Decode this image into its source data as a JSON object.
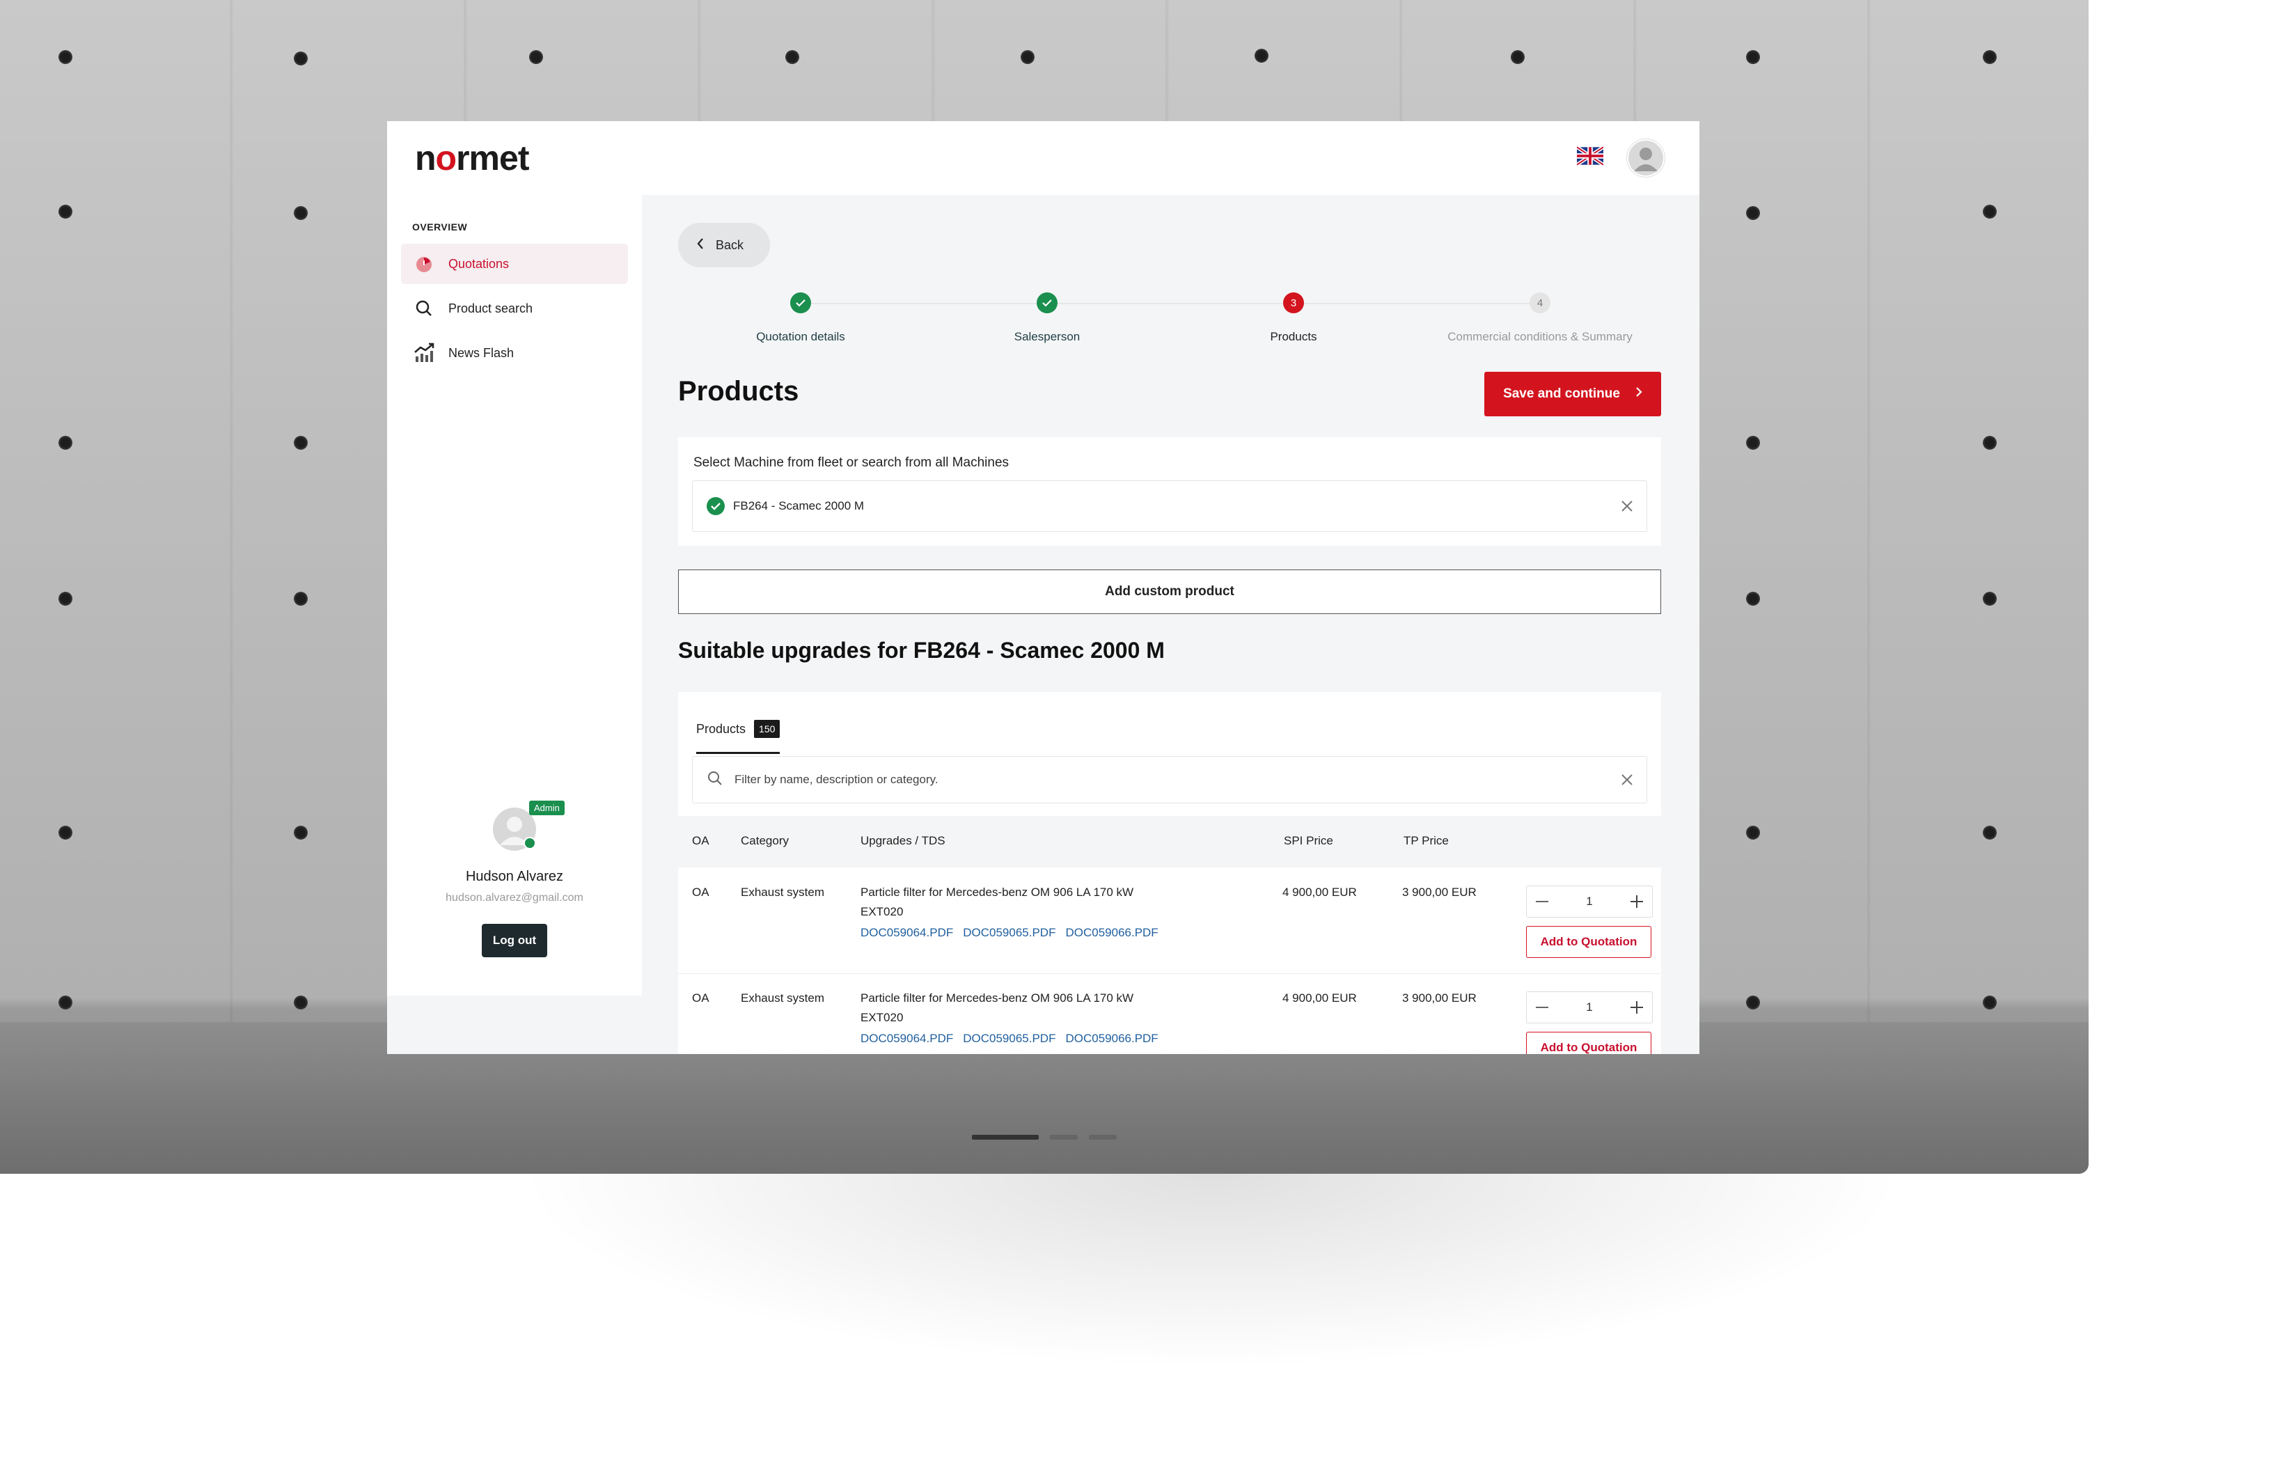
{
  "brand": {
    "logo_text_1": "n",
    "logo_text_o": "o",
    "logo_text_2": "rmet",
    "accent": "#d3141f",
    "success": "#1a8f4e"
  },
  "header": {
    "language_icon": "uk-flag-icon",
    "avatar_icon": "user-avatar-icon"
  },
  "sidebar": {
    "heading": "OVERVIEW",
    "items": [
      {
        "label": "Quotations",
        "icon": "gauge-icon",
        "active": true
      },
      {
        "label": "Product search",
        "icon": "search-icon",
        "active": false
      },
      {
        "label": "News Flash",
        "icon": "trend-chart-icon",
        "active": false
      }
    ],
    "profile": {
      "badge": "Admin",
      "name": "Hudson Alvarez",
      "email": "hudson.alvarez@gmail.com",
      "logout_label": "Log out"
    }
  },
  "main": {
    "back_label": "Back",
    "steps": [
      {
        "number": "1",
        "label": "Quotation details",
        "state": "done"
      },
      {
        "number": "2",
        "label": "Salesperson",
        "state": "done"
      },
      {
        "number": "3",
        "label": "Products",
        "state": "current"
      },
      {
        "number": "4",
        "label": "Commercial conditions & Summary",
        "state": "todo"
      }
    ],
    "title": "Products",
    "save_label": "Save and continue",
    "machine": {
      "label": "Select Machine from fleet or search from all Machines",
      "value": "FB264 - Scamec 2000 M"
    },
    "custom_product_label": "Add custom product",
    "upgrades_title": "Suitable upgrades for FB264 - Scamec 2000 M",
    "tab": {
      "label": "Products",
      "count": "150"
    },
    "filter_placeholder": "Filter by name, description or category.",
    "columns": [
      "OA",
      "Category",
      "Upgrades / TDS",
      "SPI Price",
      "TP Price"
    ],
    "rows": [
      {
        "oa": "OA",
        "category": "Exhaust system",
        "name_line1": "Particle filter for Mercedes-benz OM 906 LA 170 kW",
        "name_line2": "EXT020",
        "docs": [
          "DOC059064.PDF",
          "DOC059065.PDF",
          "DOC059066.PDF"
        ],
        "spi": "4 900,00 EUR",
        "tp": "3 900,00 EUR",
        "qty": "1",
        "add_label": "Add to Quotation"
      },
      {
        "oa": "OA",
        "category": "Exhaust system",
        "name_line1": "Particle filter for Mercedes-benz OM 906 LA 170 kW",
        "name_line2": "EXT020",
        "docs": [
          "DOC059064.PDF",
          "DOC059065.PDF",
          "DOC059066.PDF"
        ],
        "spi": "4 900,00 EUR",
        "tp": "3 900,00 EUR",
        "qty": "1",
        "add_label": "Add to Quotation"
      }
    ]
  },
  "carousel": {
    "slides": 3,
    "active": 1
  }
}
